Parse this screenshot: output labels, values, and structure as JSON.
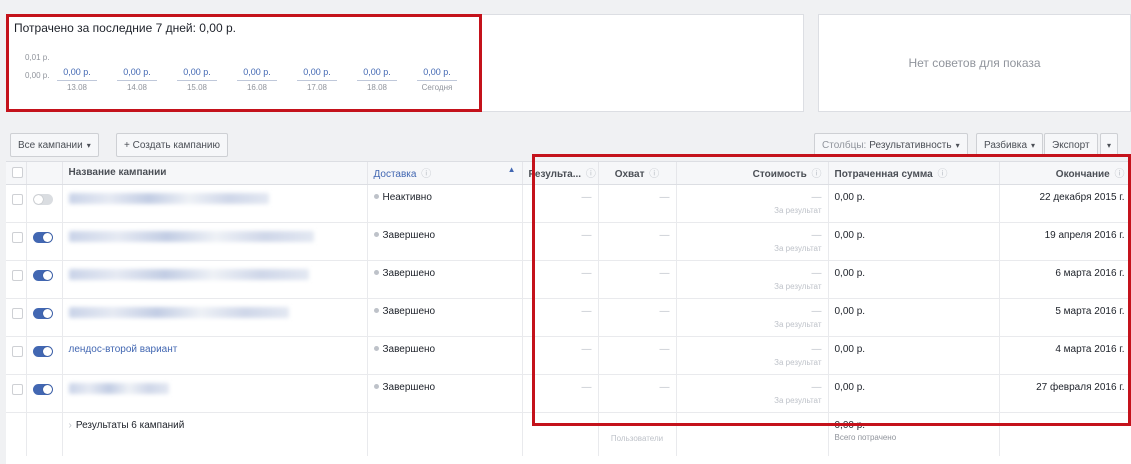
{
  "spend_panel": {
    "title": "Потрачено за последние 7 дней: 0,00 р.",
    "y_ticks": [
      "0,01 р.",
      "0,00 р."
    ],
    "days": [
      {
        "value": "0,00 р.",
        "date": "13.08"
      },
      {
        "value": "0,00 р.",
        "date": "14.08"
      },
      {
        "value": "0,00 р.",
        "date": "15.08"
      },
      {
        "value": "0,00 р.",
        "date": "16.08"
      },
      {
        "value": "0,00 р.",
        "date": "17.08"
      },
      {
        "value": "0,00 р.",
        "date": "18.08"
      },
      {
        "value": "0,00 р.",
        "date": "Сегодня"
      }
    ]
  },
  "tips_panel": {
    "text": "Нет советов для показа"
  },
  "toolbar": {
    "all_campaigns": "Все кампании",
    "create_campaign": "+ Создать кампанию",
    "columns_prefix": "Столбцы:",
    "columns_value": "Результативность",
    "breakdown": "Разбивка",
    "export": "Экспорт",
    "caret": "▾"
  },
  "table": {
    "headers": {
      "name": "Название кампании",
      "delivery": "Доставка",
      "results": "Результа...",
      "reach": "Охват",
      "cost": "Стоимость",
      "spent": "Потраченная сумма",
      "end": "Окончание"
    },
    "info_glyph": "ⓘ",
    "sort_glyph": "▲",
    "dash": "—",
    "per_result": "За результат",
    "rows": [
      {
        "name": "",
        "toggle": "off",
        "delivery": "Неактивно",
        "spent": "0,00 р.",
        "end": "22 декабря 2015 г."
      },
      {
        "name": "",
        "toggle": "on",
        "delivery": "Завершено",
        "spent": "0,00 р.",
        "end": "19 апреля 2016 г."
      },
      {
        "name": "",
        "toggle": "on",
        "delivery": "Завершено",
        "spent": "0,00 р.",
        "end": "6 марта 2016 г."
      },
      {
        "name": "",
        "toggle": "on",
        "delivery": "Завершено",
        "spent": "0,00 р.",
        "end": "5 марта 2016 г."
      },
      {
        "name": "лендос-второй вариант",
        "toggle": "on",
        "delivery": "Завершено",
        "spent": "0,00 р.",
        "end": "4 марта 2016 г."
      },
      {
        "name": "",
        "toggle": "on",
        "delivery": "Завершено",
        "spent": "0,00 р.",
        "end": "27 февраля 2016 г."
      }
    ],
    "total": {
      "label": "Результаты 6 кампаний",
      "reach_sub": "Пользователи",
      "spent": "0,00 р.",
      "spent_sub": "Всего потрачено"
    }
  },
  "colors": {
    "accent": "#4267b2",
    "highlight_box": "#c4121b",
    "toggle_off": "#dadde1"
  }
}
